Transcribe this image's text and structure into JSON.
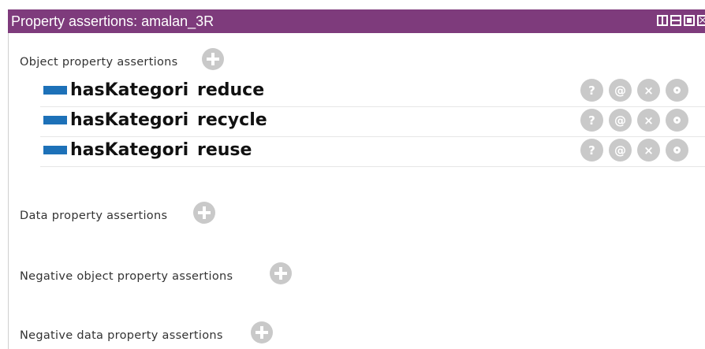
{
  "window": {
    "title": "Property assertions: amalan_3R"
  },
  "sections": {
    "object": {
      "header": "Object property assertions",
      "rows": [
        {
          "property": "hasKategori",
          "value": "reduce"
        },
        {
          "property": "hasKategori",
          "value": "recycle"
        },
        {
          "property": "hasKategori",
          "value": "reuse"
        }
      ]
    },
    "data": {
      "header": "Data property assertions"
    },
    "negative_object": {
      "header": "Negative object property assertions"
    },
    "negative_data": {
      "header": "Negative data property assertions"
    }
  },
  "row_buttons": {
    "explain": "?",
    "annotate": "@",
    "delete": "×"
  },
  "colors": {
    "titlebar": "#7e3b7c",
    "property_swatch": "#1d71b8",
    "button_gray": "#c9c9c9"
  },
  "icons": {
    "add": "add-icon",
    "explain": "question-icon",
    "annotate": "at-icon",
    "delete": "close-icon",
    "edit": "circle-icon"
  }
}
